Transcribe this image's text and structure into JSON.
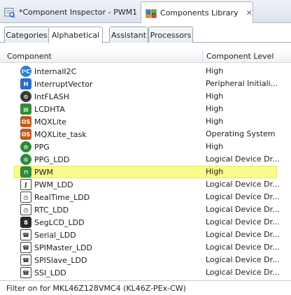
{
  "view_tabs": [
    {
      "label": "*Component Inspector - PWM1",
      "icon": "inspector-icon"
    },
    {
      "label": "Components Library",
      "icon": "library-icon",
      "close": "✕"
    }
  ],
  "sub_tabs": [
    "Categories",
    "Alphabetical",
    "Assistant",
    "Processors"
  ],
  "active_sub_tab": "Alphabetical",
  "table": {
    "columns": [
      "Component",
      "Component Level"
    ],
    "rows": [
      {
        "name": "InternalI2C",
        "level": "High",
        "icon": "i2c-icon"
      },
      {
        "name": "InterruptVector",
        "level": "Peripheral Initiali...",
        "icon": "interrupt-vector-icon"
      },
      {
        "name": "IntFLASH",
        "level": "High",
        "icon": "flash-icon"
      },
      {
        "name": "LCDHTA",
        "level": "High",
        "icon": "lcd-icon"
      },
      {
        "name": "MQXLite",
        "level": "High",
        "icon": "os-icon"
      },
      {
        "name": "MQXLite_task",
        "level": "Operating System",
        "icon": "os-icon"
      },
      {
        "name": "PPG",
        "level": "High",
        "icon": "ppg-icon"
      },
      {
        "name": "PPG_LDD",
        "level": "Logical Device Dr...",
        "icon": "ppg-icon"
      },
      {
        "name": "PWM",
        "level": "High",
        "icon": "pwm-icon",
        "selected": true
      },
      {
        "name": "PWM_LDD",
        "level": "Logical Device Dr...",
        "icon": "pwm-ldd-icon"
      },
      {
        "name": "RealTime_LDD",
        "level": "Logical Device Dr...",
        "icon": "clock-icon"
      },
      {
        "name": "RTC_LDD",
        "level": "Logical Device Dr...",
        "icon": "clock-icon"
      },
      {
        "name": "SegLCD_LDD",
        "level": "Logical Device Dr...",
        "icon": "lcd-segment-icon"
      },
      {
        "name": "Serial_LDD",
        "level": "Logical Device Dr...",
        "icon": "serial-icon"
      },
      {
        "name": "SPIMaster_LDD",
        "level": "Logical Device Dr...",
        "icon": "serial-icon"
      },
      {
        "name": "SPISlave_LDD",
        "level": "Logical Device Dr...",
        "icon": "serial-icon"
      },
      {
        "name": "SSI_LDD",
        "level": "Logical Device Dr...",
        "icon": "serial-icon"
      }
    ]
  },
  "status_text": "Filter on for MKL46Z128VMC4 (KL46Z-PEx-CW)"
}
